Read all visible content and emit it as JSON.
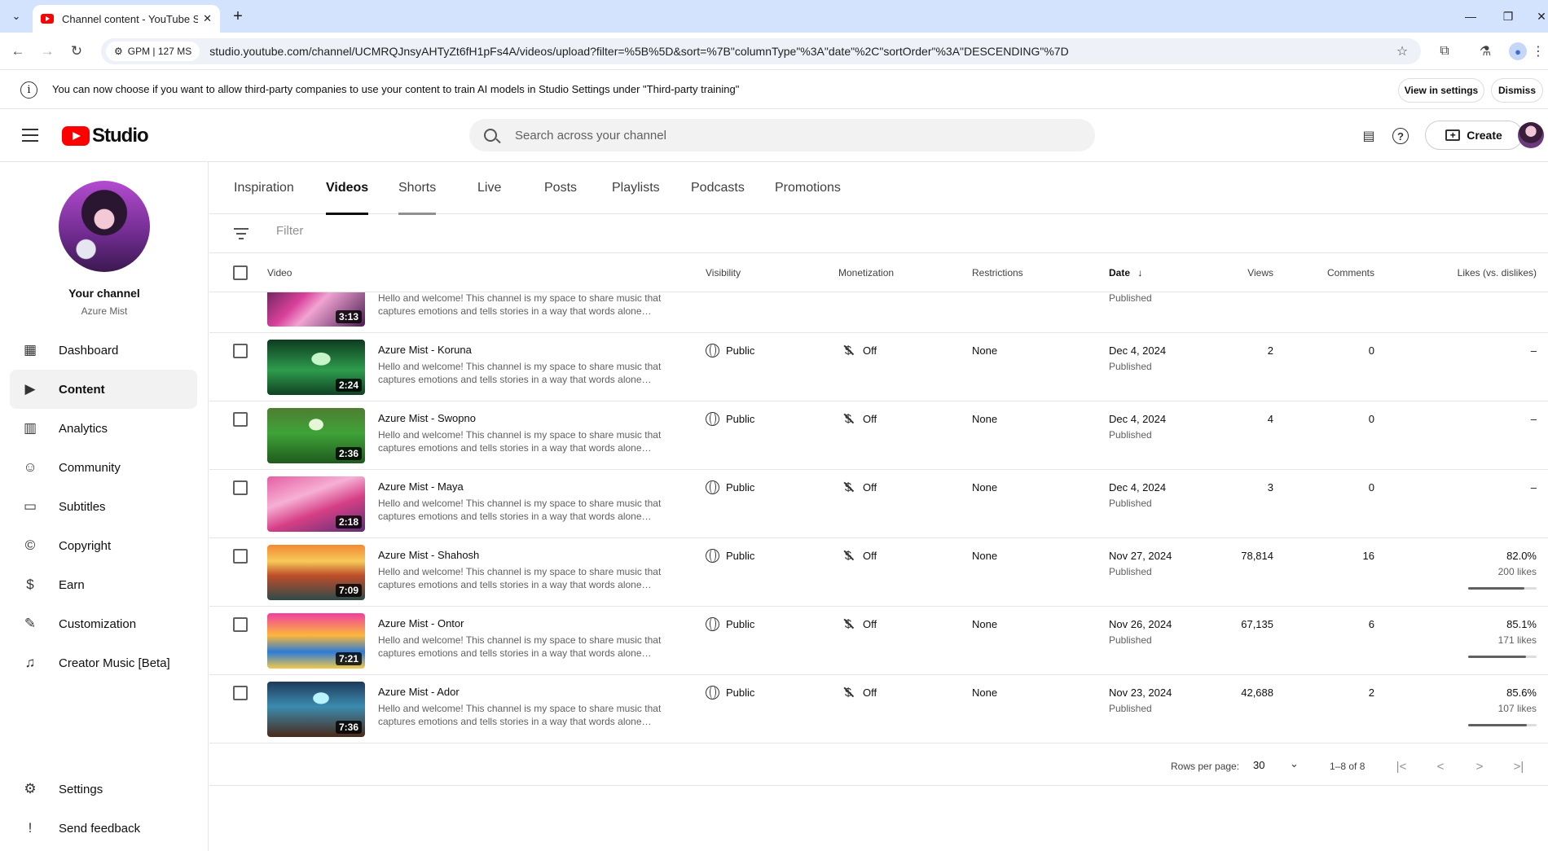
{
  "browser": {
    "tab_title": "Channel content - YouTube Studio",
    "url": "studio.youtube.com/channel/UCMRQJnsyAHTyZt6fH1pFs4A/videos/upload?filter=%5B%5D&sort=%7B\"columnType\"%3A\"date\"%2C\"sortOrder\"%3A\"DESCENDING\"%7D",
    "site_chip": "GPM | 127 MS"
  },
  "banner": {
    "text": "You can now choose if you want to allow third-party companies to use your content to train AI models in Studio Settings under \"Third-party training\"",
    "view_label": "View in settings",
    "dismiss_label": "Dismiss"
  },
  "header": {
    "logo_text": "Studio",
    "search_placeholder": "Search across your channel",
    "create_label": "Create"
  },
  "sidebar": {
    "channel_title": "Your channel",
    "channel_name": "Azure Mist",
    "items": [
      {
        "label": "Dashboard",
        "icon": "dashboard-icon"
      },
      {
        "label": "Content",
        "icon": "content-icon"
      },
      {
        "label": "Analytics",
        "icon": "analytics-icon"
      },
      {
        "label": "Community",
        "icon": "community-icon"
      },
      {
        "label": "Subtitles",
        "icon": "subtitles-icon"
      },
      {
        "label": "Copyright",
        "icon": "copyright-icon"
      },
      {
        "label": "Earn",
        "icon": "earn-icon"
      },
      {
        "label": "Customization",
        "icon": "customization-icon"
      },
      {
        "label": "Creator Music [Beta]",
        "icon": "creator-music-icon"
      }
    ],
    "bottom": [
      {
        "label": "Settings",
        "icon": "gear-icon"
      },
      {
        "label": "Send feedback",
        "icon": "feedback-icon"
      }
    ]
  },
  "tabs": [
    "Inspiration",
    "Videos",
    "Shorts",
    "Live",
    "Posts",
    "Playlists",
    "Podcasts",
    "Promotions"
  ],
  "filter_placeholder": "Filter",
  "table": {
    "headers": {
      "video": "Video",
      "visibility": "Visibility",
      "monetization": "Monetization",
      "restrictions": "Restrictions",
      "date": "Date",
      "views": "Views",
      "comments": "Comments",
      "likes": "Likes (vs. dislikes)"
    },
    "rows": [
      {
        "title": "",
        "desc": "Hello and welcome! This channel is my space to share music that captures emotions and tells stories in a way that words alone…",
        "duration": "3:13",
        "visibility": "",
        "monetization": "",
        "restrictions": "",
        "date": "",
        "status": "Published",
        "views": "",
        "comments": "",
        "likes_pct": "",
        "likes_count": "",
        "likes_ratio": null
      },
      {
        "title": "Azure Mist - Koruna",
        "desc": "Hello and welcome! This channel is my space to share music that captures emotions and tells stories in a way that words alone…",
        "duration": "2:24",
        "visibility": "Public",
        "monetization": "Off",
        "restrictions": "None",
        "date": "Dec 4, 2024",
        "status": "Published",
        "views": "2",
        "comments": "0",
        "likes_pct": "–",
        "likes_count": "",
        "likes_ratio": null
      },
      {
        "title": "Azure Mist - Swopno",
        "desc": "Hello and welcome! This channel is my space to share music that captures emotions and tells stories in a way that words alone…",
        "duration": "2:36",
        "visibility": "Public",
        "monetization": "Off",
        "restrictions": "None",
        "date": "Dec 4, 2024",
        "status": "Published",
        "views": "4",
        "comments": "0",
        "likes_pct": "–",
        "likes_count": "",
        "likes_ratio": null
      },
      {
        "title": "Azure Mist - Maya",
        "desc": "Hello and welcome! This channel is my space to share music that captures emotions and tells stories in a way that words alone…",
        "duration": "2:18",
        "visibility": "Public",
        "monetization": "Off",
        "restrictions": "None",
        "date": "Dec 4, 2024",
        "status": "Published",
        "views": "3",
        "comments": "0",
        "likes_pct": "–",
        "likes_count": "",
        "likes_ratio": null
      },
      {
        "title": "Azure Mist - Shahosh",
        "desc": "Hello and welcome! This channel is my space to share music that captures emotions and tells stories in a way that words alone…",
        "duration": "7:09",
        "visibility": "Public",
        "monetization": "Off",
        "restrictions": "None",
        "date": "Nov 27, 2024",
        "status": "Published",
        "views": "78,814",
        "comments": "16",
        "likes_pct": "82.0%",
        "likes_count": "200 likes",
        "likes_ratio": 0.82
      },
      {
        "title": "Azure Mist - Ontor",
        "desc": "Hello and welcome! This channel is my space to share music that captures emotions and tells stories in a way that words alone…",
        "duration": "7:21",
        "visibility": "Public",
        "monetization": "Off",
        "restrictions": "None",
        "date": "Nov 26, 2024",
        "status": "Published",
        "views": "67,135",
        "comments": "6",
        "likes_pct": "85.1%",
        "likes_count": "171 likes",
        "likes_ratio": 0.851
      },
      {
        "title": "Azure Mist - Ador",
        "desc": "Hello and welcome! This channel is my space to share music that captures emotions and tells stories in a way that words alone…",
        "duration": "7:36",
        "visibility": "Public",
        "monetization": "Off",
        "restrictions": "None",
        "date": "Nov 23, 2024",
        "status": "Published",
        "views": "42,688",
        "comments": "2",
        "likes_pct": "85.6%",
        "likes_count": "107 likes",
        "likes_ratio": 0.856
      }
    ]
  },
  "pagination": {
    "rows_per_page_label": "Rows per page:",
    "rows_per_page": "30",
    "range": "1–8 of 8"
  }
}
